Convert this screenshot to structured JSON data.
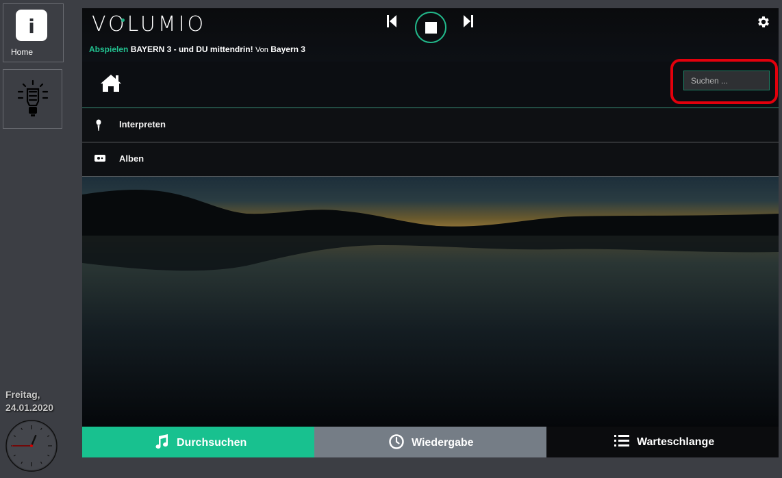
{
  "sidebar": {
    "home_tile": {
      "icon": "info-icon",
      "glyph": "i",
      "label": "Home"
    },
    "light_tile": {
      "icon": "lightbulb-icon"
    }
  },
  "datetime": {
    "weekday": "Freitag,",
    "date": "24.01.2020"
  },
  "clock": {
    "hour": 12,
    "minute": 45,
    "second": 45
  },
  "player": {
    "logo": "VOLUMIO",
    "state_verb": "Abspielen",
    "title": "BAYERN 3 - und DU mittendrin!",
    "by_label": "Von",
    "artist": "Bayern 3",
    "accent": "#22c08f"
  },
  "toolbar": {
    "search_placeholder": "Suchen ...",
    "home_icon": "home-icon"
  },
  "browse_list": [
    {
      "icon": "microphone-icon",
      "label": "Interpreten"
    },
    {
      "icon": "album-icon",
      "label": "Alben"
    }
  ],
  "bottom_nav": {
    "browse": {
      "label": "Durchsuchen",
      "icon": "music-note-icon",
      "color": "#18c18f"
    },
    "playback": {
      "label": "Wiedergabe",
      "icon": "clock-icon",
      "color": "#757d86"
    },
    "queue": {
      "label": "Warteschlange",
      "icon": "list-icon",
      "color": "#0b0c0e"
    }
  }
}
